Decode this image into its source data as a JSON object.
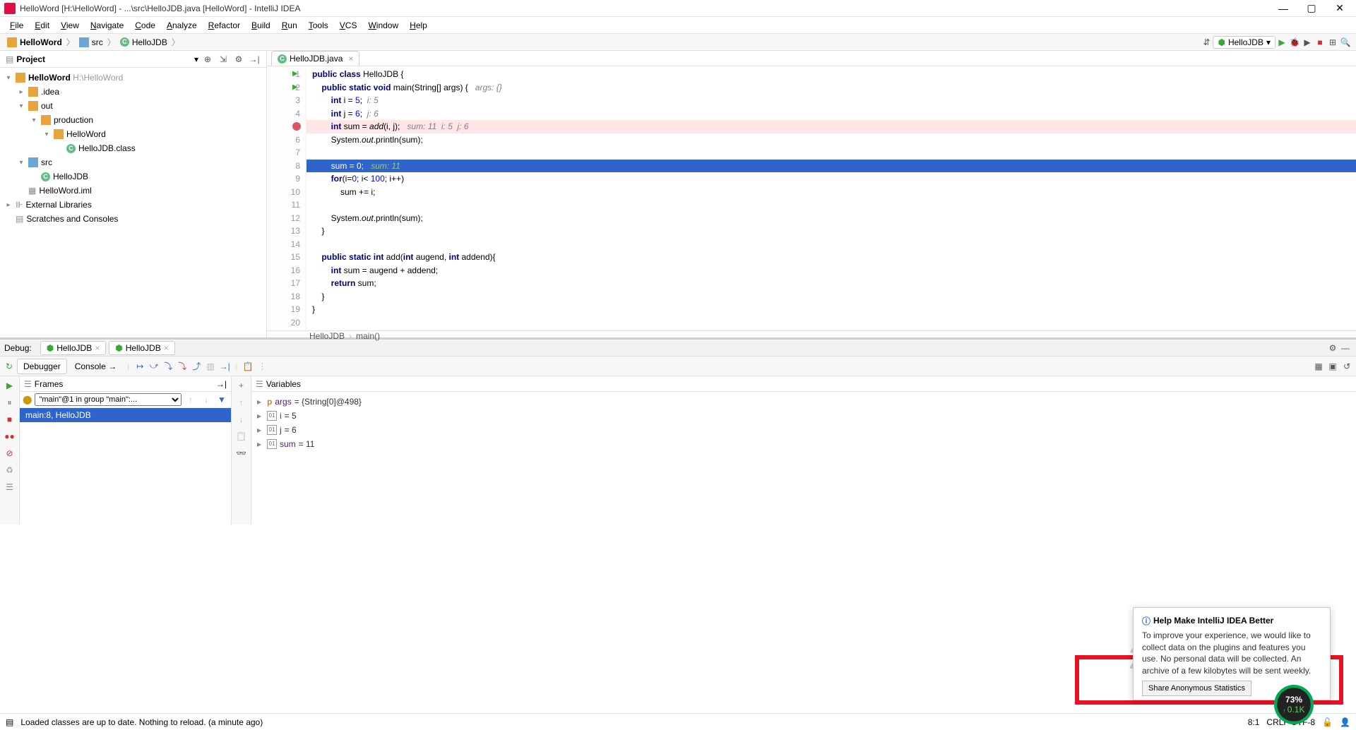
{
  "title": "HelloWord [H:\\HelloWord] - ...\\src\\HelloJDB.java [HelloWord] - IntelliJ IDEA",
  "menu": [
    "File",
    "Edit",
    "View",
    "Navigate",
    "Code",
    "Analyze",
    "Refactor",
    "Build",
    "Run",
    "Tools",
    "VCS",
    "Window",
    "Help"
  ],
  "breadcrumbs": [
    {
      "icon": "folder",
      "label": "HelloWord"
    },
    {
      "icon": "folder-blue",
      "label": "src"
    },
    {
      "icon": "c",
      "label": "HelloJDB"
    }
  ],
  "run_config": "HelloJDB",
  "project_pane": {
    "title": "Project"
  },
  "tree": [
    {
      "d": 0,
      "t": "▾",
      "i": "folder",
      "l": "HelloWord",
      "sub": "H:\\HelloWord",
      "bold": true
    },
    {
      "d": 1,
      "t": "▸",
      "i": "folder",
      "l": ".idea"
    },
    {
      "d": 1,
      "t": "▾",
      "i": "folder-o",
      "l": "out"
    },
    {
      "d": 2,
      "t": "▾",
      "i": "folder-o",
      "l": "production"
    },
    {
      "d": 3,
      "t": "▾",
      "i": "folder-o",
      "l": "HelloWord"
    },
    {
      "d": 4,
      "t": "",
      "i": "c",
      "l": "HelloJDB.class"
    },
    {
      "d": 1,
      "t": "▾",
      "i": "folder-blue",
      "l": "src"
    },
    {
      "d": 2,
      "t": "",
      "i": "c",
      "l": "HelloJDB"
    },
    {
      "d": 1,
      "t": "",
      "i": "iml",
      "l": "HelloWord.iml"
    },
    {
      "d": 0,
      "t": "▸",
      "i": "lib",
      "l": "External Libraries"
    },
    {
      "d": 0,
      "t": "",
      "i": "scratch",
      "l": "Scratches and Consoles"
    }
  ],
  "tab": {
    "label": "HelloJDB.java"
  },
  "code_lines": [
    {
      "n": 1,
      "play": true,
      "html": "<span class='kw'>public</span> <span class='kw'>class</span> HelloJDB {"
    },
    {
      "n": 2,
      "play": true,
      "html": "    <span class='kw'>public</span> <span class='kw'>static</span> <span class='kw'>void</span> main(String[] args) {   <span class='cmt'>args: {}</span>"
    },
    {
      "n": 3,
      "html": "        <span class='kw'>int</span> i = <span class='num'>5</span>;  <span class='cmt'>i: 5</span>"
    },
    {
      "n": 4,
      "html": "        <span class='kw'>int</span> j = <span class='num'>6</span>;  <span class='cmt'>j: 6</span>"
    },
    {
      "n": 5,
      "bp": true,
      "cls": "hl-red",
      "html": "        <span class='kw'>int</span> sum = <span class='fn'>add</span>(i, j);   <span class='cmt'>sum: 11  i: 5  j: 6</span>"
    },
    {
      "n": 6,
      "html": "        System.<span class='fn'>out</span>.println(sum);"
    },
    {
      "n": 7,
      "html": ""
    },
    {
      "n": 8,
      "cls": "hl-blue",
      "html": "        sum = <span class='num'>0</span>;   <span class='cmt2'>sum: 11</span>"
    },
    {
      "n": 9,
      "html": "        <span class='kw'>for</span>(i=<span class='num'>0</span>; i&lt; <span class='num'>100</span>; i++)"
    },
    {
      "n": 10,
      "html": "            sum += i;"
    },
    {
      "n": 11,
      "html": ""
    },
    {
      "n": 12,
      "html": "        System.<span class='fn'>out</span>.println(sum);"
    },
    {
      "n": 13,
      "html": "    }"
    },
    {
      "n": 14,
      "html": ""
    },
    {
      "n": 15,
      "html": "    <span class='kw'>public</span> <span class='kw'>static</span> <span class='kw'>int</span> add(<span class='kw'>int</span> augend, <span class='kw'>int</span> addend){"
    },
    {
      "n": 16,
      "html": "        <span class='kw'>int</span> sum = augend + addend;"
    },
    {
      "n": 17,
      "html": "        <span class='kw'>return</span> sum;"
    },
    {
      "n": 18,
      "html": "    }"
    },
    {
      "n": 19,
      "html": "}"
    },
    {
      "n": 20,
      "html": ""
    }
  ],
  "editor_crumb": [
    "HelloJDB",
    "main()"
  ],
  "debug": {
    "label": "Debug:",
    "tabs": [
      "HelloJDB",
      "HelloJDB"
    ],
    "subtabs": [
      "Debugger",
      "Console"
    ],
    "frames_title": "Frames",
    "thread": "\"main\"@1 in group \"main\":...",
    "frame": "main:8, HelloJDB",
    "vars_title": "Variables",
    "vars": [
      {
        "badge": "p",
        "name": "args",
        "val": "= {String[0]@498}"
      },
      {
        "badge": "01",
        "name": "i",
        "val": "= 5"
      },
      {
        "badge": "01",
        "name": "j",
        "val": "= 6"
      },
      {
        "badge": "01",
        "name": "sum",
        "val": "= 11"
      }
    ]
  },
  "popup": {
    "title": "Help Make IntelliJ IDEA Better",
    "text": "To improve your experience, we would like to collect data on the plugins and features you use. No personal data will be collected. An archive of a few kilobytes will be sent weekly.",
    "btn": "Share Anonymous Statistics"
  },
  "watermark": "20175216",
  "gauge": {
    "pct": "73%",
    "rate": "0.1K"
  },
  "status": {
    "msg": "Loaded classes are up to date. Nothing to reload. (a minute ago)",
    "pos": "8:1",
    "ins": "CRLF  UTF-8"
  }
}
